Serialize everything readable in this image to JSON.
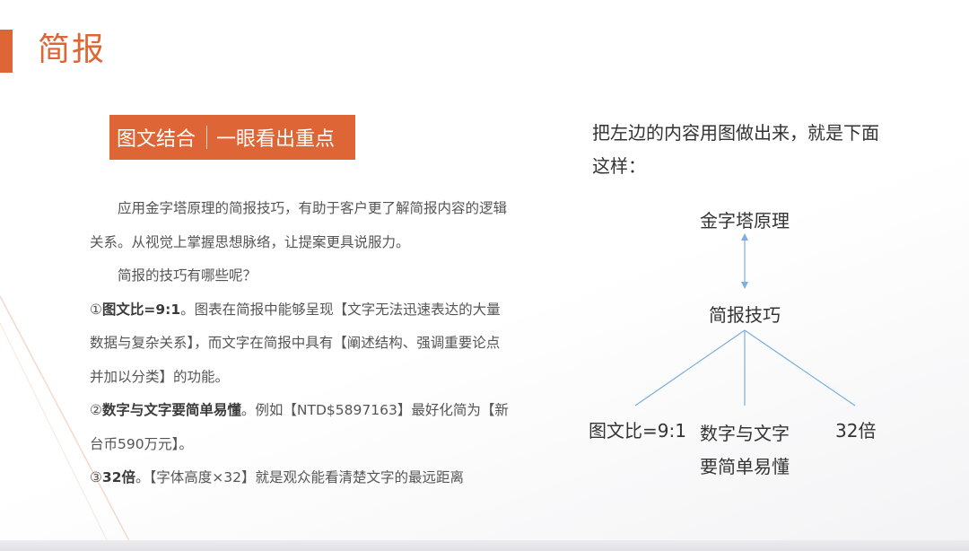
{
  "colors": {
    "accent": "#de6535",
    "text": "#555555",
    "diagram_line": "#7aaedc"
  },
  "slide": {
    "title": "简报",
    "tag": {
      "part1": "图文结合",
      "part2": "一眼看出重点"
    },
    "intro_paragraph": "应用金字塔原理的简报技巧，有助于客户更了解简报内容的逻辑关系。从视觉上掌握思想脉络，让提案更具说服力。",
    "question": "简报的技巧有哪些呢？",
    "tips": [
      {
        "num": "①",
        "bold": "图文比=9:1",
        "text": "。图表在简报中能够呈现【文字无法迅速表达的大量数据与复杂关系】，而文字在简报中具有【阐述结构、强调重要论点并加以分类】的功能。"
      },
      {
        "num": "②",
        "bold": "数字与文字要简单易懂",
        "text": "。例如【NTD$5897163】最好化简为【新台币590万元】。"
      },
      {
        "num": "③",
        "bold": "32倍",
        "text": "。【字体高度×32】就是观众能看清楚文字的最远距离"
      }
    ]
  },
  "diagram": {
    "intro": "把左边的内容用图做出来，就是下面这样：",
    "top_node": "金字塔原理",
    "mid_node": "简报技巧",
    "leaves": [
      "图文比=9:1",
      "数字与文字要简单易懂",
      "32倍"
    ]
  }
}
